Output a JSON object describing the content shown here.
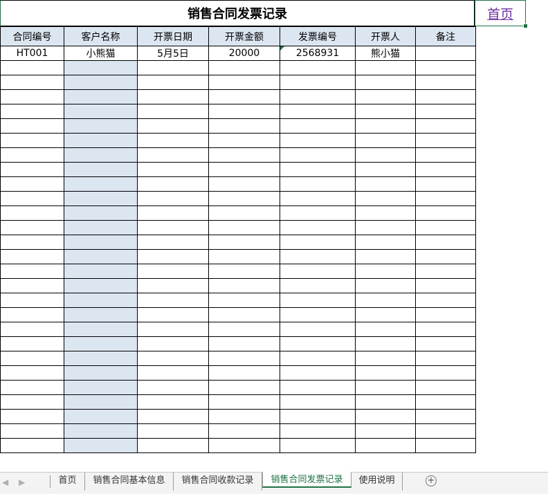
{
  "sheet": {
    "title": "销售合同发票记录",
    "home_link": "首页",
    "columns": [
      "合同编号",
      "客户名称",
      "开票日期",
      "开票金额",
      "发票编号",
      "开票人",
      "备注"
    ],
    "rows": [
      [
        "HT001",
        "小熊猫",
        "5月5日",
        "20000",
        "2568931",
        "熊小猫",
        ""
      ]
    ],
    "empty_row_count": 27,
    "colors": {
      "header_fill": "#dce6f1",
      "accent": "#1e7145",
      "link": "#7030a0"
    }
  },
  "tabs": {
    "items": [
      "首页",
      "销售合同基本信息",
      "销售合同收款记录",
      "销售合同发票记录",
      "使用说明"
    ],
    "active": "销售合同发票记录",
    "add_icon": "plus-circle-icon",
    "nav_icons": [
      "chevron-left-icon",
      "chevron-right-icon"
    ]
  }
}
